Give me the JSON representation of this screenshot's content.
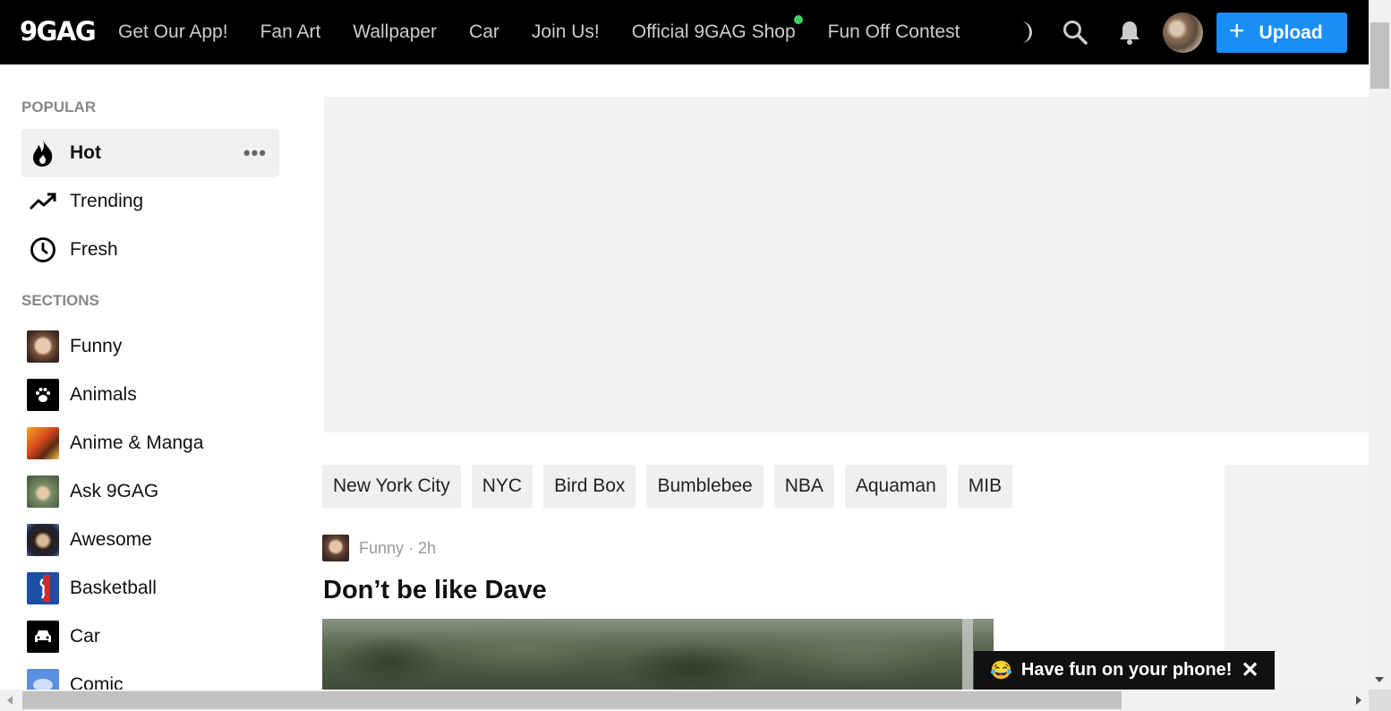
{
  "header": {
    "logo": "9GAG",
    "nav": [
      {
        "label": "Get Our App!"
      },
      {
        "label": "Fan Art"
      },
      {
        "label": "Wallpaper"
      },
      {
        "label": "Car"
      },
      {
        "label": "Join Us!"
      },
      {
        "label": "Official 9GAG Shop",
        "dot": true
      },
      {
        "label": "Fun Off Contest"
      }
    ],
    "icons": [
      "moon-icon",
      "search-icon",
      "bell-icon"
    ],
    "upload_label": "Upload",
    "upload_color": "#1a8ef7",
    "new_dot_color": "#3fd065"
  },
  "sidebar": {
    "popular_heading": "POPULAR",
    "popular": [
      {
        "label": "Hot",
        "icon": "flame-icon",
        "active": true,
        "more": "•••"
      },
      {
        "label": "Trending",
        "icon": "trending-icon"
      },
      {
        "label": "Fresh",
        "icon": "clock-icon"
      }
    ],
    "sections_heading": "SECTIONS",
    "sections": [
      {
        "label": "Funny",
        "icon": "funny-thumb"
      },
      {
        "label": "Animals",
        "icon": "paw-icon"
      },
      {
        "label": "Anime & Manga",
        "icon": "anime-thumb"
      },
      {
        "label": "Ask 9GAG",
        "icon": "ask-thumb"
      },
      {
        "label": "Awesome",
        "icon": "awesome-thumb"
      },
      {
        "label": "Basketball",
        "icon": "nba-logo-icon"
      },
      {
        "label": "Car",
        "icon": "car-icon"
      },
      {
        "label": "Comic",
        "icon": "comic-icon"
      }
    ]
  },
  "tags": [
    "New York City",
    "NYC",
    "Bird Box",
    "Bumblebee",
    "NBA",
    "Aquaman",
    "MIB"
  ],
  "post": {
    "section": "Funny",
    "age": "2h",
    "meta": "Funny · 2h",
    "title": "Don’t be like Dave"
  },
  "toast": {
    "emoji": "😂",
    "text": "Have fun on your phone!",
    "close": "✕"
  }
}
